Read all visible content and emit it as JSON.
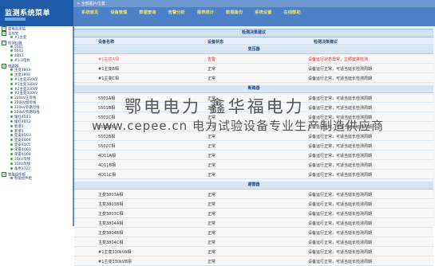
{
  "app": {
    "title": "监测系统菜单",
    "breadcrumb": "> 全部图片位置："
  },
  "nav": {
    "items": [
      "系统首页",
      "设备管理",
      "数据查询",
      "告警分析",
      "报表统计",
      "数据备份",
      "系统设置",
      "在线帮助"
    ]
  },
  "sidebar": {
    "items": [
      {
        "label": "变电监测站",
        "type": "folder"
      },
      {
        "label": "主控室",
        "type": "folder"
      },
      {
        "label": "#1主变",
        "type": "leaf"
      },
      {
        "label": "检测仪器",
        "type": "folder"
      },
      {
        "label": "5501",
        "type": "leaf"
      },
      {
        "label": "5502",
        "type": "leaf"
      },
      {
        "label": "4Q11",
        "type": "leaf"
      },
      {
        "label": "#1-3电抗",
        "type": "leaf"
      },
      {
        "label": "线路器",
        "type": "folder"
      },
      {
        "label": "主变3803",
        "type": "leaf"
      },
      {
        "label": "主变3804",
        "type": "leaf"
      },
      {
        "label": "#1主变330kV",
        "type": "leaf"
      },
      {
        "label": "#1主变330kV",
        "type": "leaf"
      },
      {
        "label": "#2主变330kV",
        "type": "leaf"
      },
      {
        "label": "#2主变330kV",
        "type": "leaf"
      },
      {
        "label": "220kV正母线",
        "type": "leaf"
      },
      {
        "label": "220kV副母线",
        "type": "leaf"
      },
      {
        "label": "220kV旁路母线",
        "type": "leaf"
      },
      {
        "label": "220kV旁路母线",
        "type": "leaf"
      },
      {
        "label": "缓红4Q11",
        "type": "leaf"
      },
      {
        "label": "缓红4Q12",
        "type": "leaf"
      },
      {
        "label": "新增1",
        "type": "leaf"
      },
      {
        "label": "新增3",
        "type": "leaf"
      },
      {
        "label": "亚安4Q03",
        "type": "leaf"
      },
      {
        "label": "亚安4Q04",
        "type": "leaf"
      },
      {
        "label": "亚安4Q05",
        "type": "leaf"
      },
      {
        "label": "荣雷4Q03",
        "type": "leaf"
      },
      {
        "label": "荣雷4Q04",
        "type": "leaf"
      },
      {
        "label": "35kV母线",
        "type": "leaf"
      },
      {
        "label": "35kV母线",
        "type": "leaf"
      },
      {
        "label": "备用3722",
        "type": "leaf"
      },
      {
        "label": "智能组件柜",
        "type": "folder"
      },
      {
        "label": "智能组件柜",
        "type": "leaf"
      }
    ]
  },
  "panel": {
    "title": "检测决策建议",
    "columns": [
      "设备名称",
      "设备状态",
      "检测决策建议"
    ]
  },
  "sections": [
    {
      "title": "变压器",
      "rows": [
        {
          "name": "#1主变A相",
          "status": "告警",
          "advice": "设备运行状态异常，立即安排检测",
          "alert": true
        },
        {
          "name": "#1主变B相",
          "status": "正常",
          "advice": "设备运行正常，可适当延长检测周期",
          "alert": false
        },
        {
          "name": "#1主变C相",
          "status": "正常",
          "advice": "设备运行正常，可适当延长检测周期",
          "alert": false
        }
      ]
    },
    {
      "title": "断路器",
      "rows": [
        {
          "name": "5501A相",
          "status": "正常",
          "advice": "设备运行正常，可适当延长检测周期",
          "alert": false
        },
        {
          "name": "5501B相",
          "status": "正常",
          "advice": "设备运行正常，可适当延长检测周期",
          "alert": false
        },
        {
          "name": "5501C相",
          "status": "正常",
          "advice": "设备运行正常，可适当延长检测周期",
          "alert": false
        },
        {
          "name": "5502A相",
          "status": "正常",
          "advice": "设备运行正常，可适当延长检测周期",
          "alert": false
        },
        {
          "name": "5502B相",
          "status": "正常",
          "advice": "设备运行正常，可适当延长检测周期",
          "alert": false
        },
        {
          "name": "5502C相",
          "status": "正常",
          "advice": "设备运行正常，可适当延长检测周期",
          "alert": false
        },
        {
          "name": "4Q11A相",
          "status": "正常",
          "advice": "设备运行正常，可适当延长检测周期",
          "alert": false
        },
        {
          "name": "4Q11B相",
          "status": "正常",
          "advice": "设备运行正常，可适当延长检测周期",
          "alert": false
        },
        {
          "name": "4Q11C相",
          "status": "正常",
          "advice": "设备运行正常，可适当延长检测周期",
          "alert": false
        }
      ]
    },
    {
      "title": "避雷器",
      "rows": [
        {
          "name": "主变3803A相",
          "status": "正常",
          "advice": "设备运行正常，可适当延长检测周期",
          "alert": false
        },
        {
          "name": "主变3803B相",
          "status": "正常",
          "advice": "设备运行正常，可适当延长检测周期",
          "alert": false
        },
        {
          "name": "主变3803C相",
          "status": "正常",
          "advice": "设备运行正常，可适当延长检测周期",
          "alert": false
        },
        {
          "name": "主变3804A相",
          "status": "正常",
          "advice": "设备运行正常，可适当延长检测周期",
          "alert": false
        },
        {
          "name": "主变3804B相",
          "status": "正常",
          "advice": "设备运行正常，可适当延长检测周期",
          "alert": false
        },
        {
          "name": "主变3804C相",
          "status": "正常",
          "advice": "设备运行正常，可适当延长检测周期",
          "alert": false
        },
        {
          "name": "#1主变330kVA相",
          "status": "正常",
          "advice": "设备运行正常，可适当延长检测周期",
          "alert": false
        },
        {
          "name": "#1主变330kVB相",
          "status": "正常",
          "advice": "设备运行正常，可适当延长检测周期",
          "alert": false
        }
      ]
    }
  ],
  "watermark": {
    "line1": "鄂电电力 鑫华福电力",
    "line2": "www.cepee.cn  电力试验设备专业生产制造供应商"
  },
  "colors": {
    "header": "#4d80c6",
    "logo": "#1e5aa8",
    "alert": "#e0262a",
    "menu_text": "#e9e27a"
  }
}
